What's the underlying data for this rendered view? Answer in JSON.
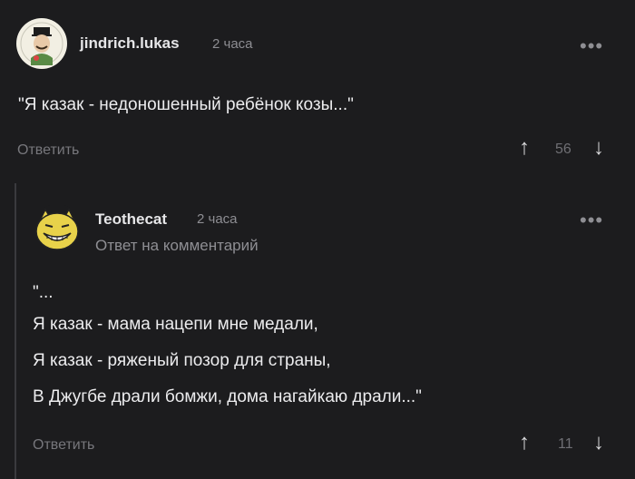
{
  "comment": {
    "author": "jindrich.lukas",
    "time": "2 часа",
    "text": "\"Я казак - недоношенный ребёнок козы...\"",
    "reply_label": "Ответить",
    "vote_count": "56",
    "more_label": "•••"
  },
  "reply": {
    "author": "Teothecat",
    "time": "2 часа",
    "subtitle": "Ответ на комментарий",
    "lines": [
      "\"...",
      "Я казак - мама нацепи мне медали,",
      "Я казак - ряженый позор для страны,",
      "В Джугбе драли бомжи, дома нагайкаю драли...\""
    ],
    "reply_label": "Ответить",
    "vote_count": "11",
    "more_label": "•••"
  },
  "icons": {
    "upvote": "arrow-up-icon",
    "downvote": "arrow-down-icon",
    "more": "more-dots-icon"
  },
  "colors": {
    "background": "#1c1c1e",
    "text": "#ececee",
    "muted": "#8e8e93",
    "thread_line": "#3a3a3e"
  }
}
